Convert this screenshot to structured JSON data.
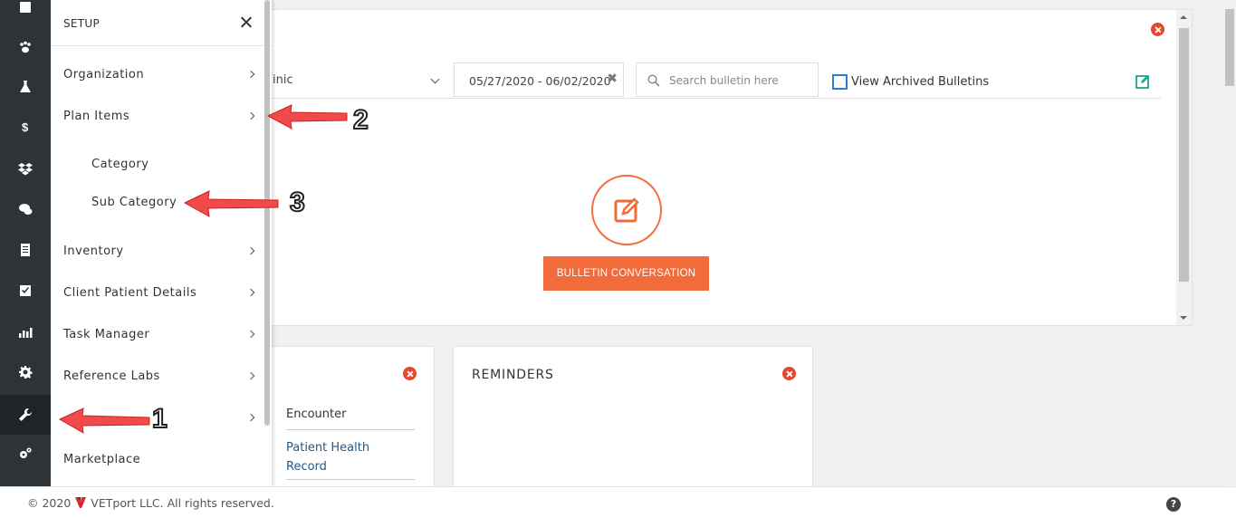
{
  "drawer": {
    "title": "SETUP",
    "items": [
      {
        "label": "Organization"
      },
      {
        "label": "Plan Items"
      },
      {
        "label": "Inventory"
      },
      {
        "label": "Client Patient Details"
      },
      {
        "label": "Task Manager"
      },
      {
        "label": "Reference Labs"
      },
      {
        "label": "Marketplace"
      }
    ],
    "sub_items": [
      {
        "label": "Category"
      },
      {
        "label": "Sub Category"
      }
    ]
  },
  "rail": {
    "icons": [
      "calendar-icon",
      "paw-icon",
      "flask-icon",
      "dollar-icon",
      "dropbox-icon",
      "chat-icon",
      "document-icon",
      "checkbox-icon",
      "chart-icon",
      "gear-icon",
      "wrench-icon",
      "gears-icon"
    ],
    "active": "wrench-icon"
  },
  "bulletin": {
    "clinic_value": "inic",
    "date_range": "05/27/2020 - 06/02/2020",
    "search_placeholder": "Search bulletin here",
    "archived_label": "View Archived Bulletins",
    "button_label": "BULLETIN CONVERSATION"
  },
  "encounter": {
    "header": "Encounter",
    "link": "Patient Health Record"
  },
  "reminders": {
    "title": "REMINDERS"
  },
  "footer": {
    "copyright_prefix": "© 2020",
    "copyright_suffix": "VETport LLC. All rights reserved.",
    "help": "?"
  },
  "annotations": {
    "numbers": [
      "1",
      "2",
      "3"
    ],
    "color": "#f04a4a"
  },
  "colors": {
    "accent": "#f26b3a",
    "rail": "#2e3338",
    "close": "#e8452c",
    "checkbox": "#2b7cd3",
    "edit": "#19a58e",
    "link": "#1f5a8a"
  }
}
